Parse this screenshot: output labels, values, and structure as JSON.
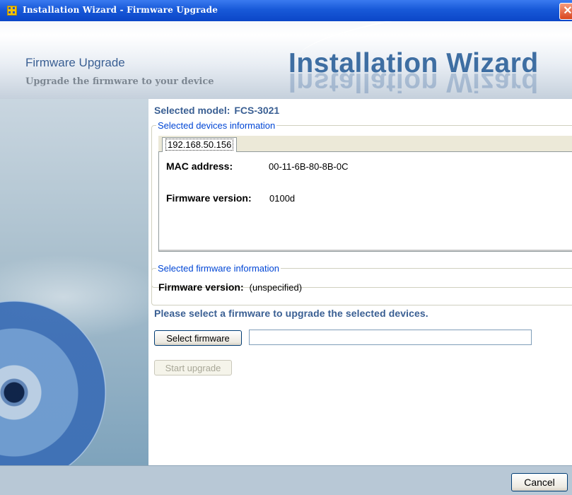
{
  "window": {
    "title": "Installation Wizard - Firmware Upgrade",
    "close_glyph": "✕"
  },
  "header": {
    "page_title": "Firmware Upgrade",
    "page_subtitle": "Upgrade the firmware to your device",
    "brand": "Installation Wizard"
  },
  "main": {
    "selected_model_label": "Selected model:",
    "selected_model_value": "FCS-3021",
    "devices_group_label": "Selected devices information",
    "device_tab": "192.168.50.156",
    "mac_label": "MAC address:",
    "mac_value": "00-11-6B-80-8B-0C",
    "fw_version_label": "Firmware version:",
    "fw_version_value": "0100d",
    "firmware_group_label": "Selected firmware information",
    "selected_fw_label": "Firmware version:",
    "selected_fw_value": "(unspecified)",
    "prompt": "Please select a firmware to upgrade the selected devices.",
    "select_firmware_button": "Select firmware",
    "firmware_path_value": "",
    "start_upgrade_button": "Start upgrade"
  },
  "footer": {
    "cancel_button": "Cancel"
  }
}
